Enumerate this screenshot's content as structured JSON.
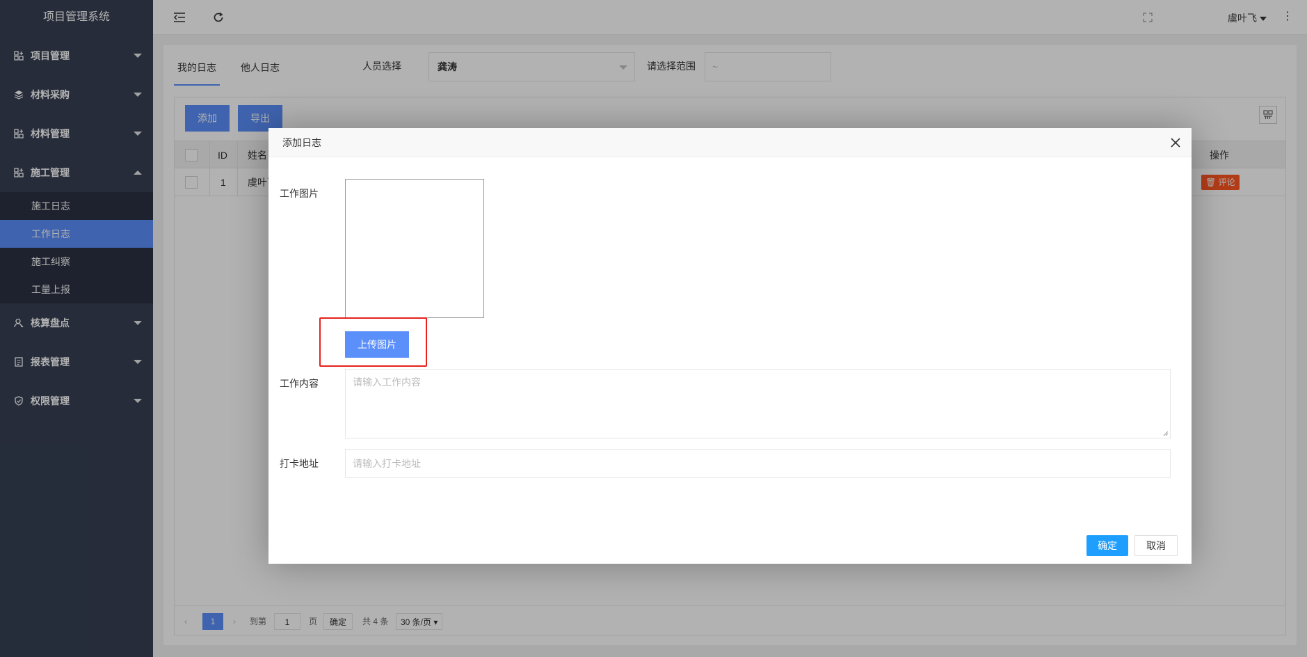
{
  "app": {
    "title": "项目管理系统"
  },
  "sidebar": {
    "items": [
      {
        "label": "项目管理",
        "icon": "project-icon"
      },
      {
        "label": "材料采购",
        "icon": "layers-icon"
      },
      {
        "label": "材料管理",
        "icon": "material-icon"
      },
      {
        "label": "施工管理",
        "icon": "construction-icon",
        "expanded": true,
        "children": [
          {
            "label": "施工日志"
          },
          {
            "label": "工作日志",
            "active": true
          },
          {
            "label": "施工纠察"
          },
          {
            "label": "工量上报"
          }
        ]
      },
      {
        "label": "核算盘点",
        "icon": "user-icon"
      },
      {
        "label": "报表管理",
        "icon": "report-icon"
      },
      {
        "label": "权限管理",
        "icon": "shield-icon"
      }
    ]
  },
  "topbar": {
    "user": "虞叶飞"
  },
  "main": {
    "tabs": [
      "我的日志",
      "他人日志"
    ],
    "person_label": "人员选择",
    "person_value": "龚涛",
    "range_label": "请选择范围",
    "range_placeholder": "~",
    "add_label": "添加",
    "export_label": "导出",
    "table": {
      "headers": {
        "id": "ID",
        "name": "姓名",
        "action": "操作"
      },
      "rows": [
        {
          "id": "1",
          "name": "虞叶飞",
          "action": "评论"
        }
      ]
    },
    "pager": {
      "current": "1",
      "goto_label": "到第",
      "goto_value": "1",
      "page_unit": "页",
      "confirm": "确定",
      "total": "共 4 条",
      "per_page": "30 条/页"
    }
  },
  "modal": {
    "title": "添加日志",
    "image_label": "工作图片",
    "upload_label": "上传图片",
    "content_label": "工作内容",
    "content_placeholder": "请输入工作内容",
    "address_label": "打卡地址",
    "address_placeholder": "请输入打卡地址",
    "ok": "确定",
    "cancel": "取消"
  },
  "colors": {
    "sidebar": "#374053",
    "accent": "#5b8ff9",
    "ok": "#1e9fff",
    "danger": "#ff5722",
    "highlight": "#e8201a"
  }
}
